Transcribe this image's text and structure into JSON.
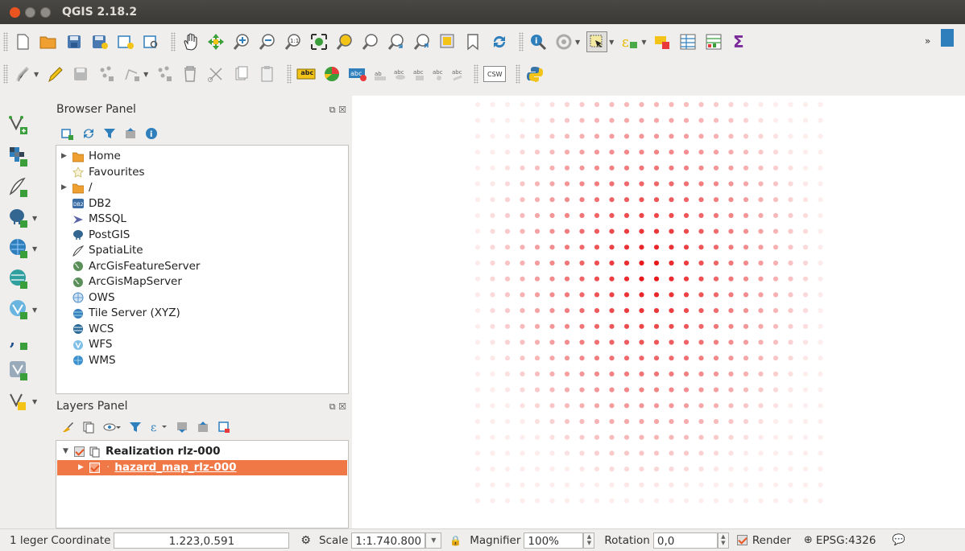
{
  "window": {
    "title": "QGIS 2.18.2"
  },
  "toolbar_row2": {
    "label_button": "abc",
    "csw_button": "CSW"
  },
  "browser_panel": {
    "title": "Browser Panel",
    "items": [
      {
        "label": "Home",
        "icon": "folder-icon",
        "expandable": true
      },
      {
        "label": "Favourites",
        "icon": "star-icon",
        "expandable": false
      },
      {
        "label": "/",
        "icon": "folder-icon",
        "expandable": true
      },
      {
        "label": "DB2",
        "icon": "db2-icon",
        "expandable": false
      },
      {
        "label": "MSSQL",
        "icon": "mssql-icon",
        "expandable": false
      },
      {
        "label": "PostGIS",
        "icon": "postgis-elephant-icon",
        "expandable": false
      },
      {
        "label": "SpatiaLite",
        "icon": "spatialite-feather-icon",
        "expandable": false
      },
      {
        "label": "ArcGisFeatureServer",
        "icon": "arcgis-globe-icon",
        "expandable": false
      },
      {
        "label": "ArcGisMapServer",
        "icon": "arcgis-globe-icon",
        "expandable": false
      },
      {
        "label": "OWS",
        "icon": "ows-globe-icon",
        "expandable": false
      },
      {
        "label": "Tile Server (XYZ)",
        "icon": "xyz-globe-icon",
        "expandable": false
      },
      {
        "label": "WCS",
        "icon": "wcs-globe-icon",
        "expandable": false
      },
      {
        "label": "WFS",
        "icon": "wfs-globe-icon",
        "expandable": false
      },
      {
        "label": "WMS",
        "icon": "wms-globe-icon",
        "expandable": false
      }
    ]
  },
  "layers_panel": {
    "title": "Layers Panel",
    "group": {
      "label": "Realization rlz-000",
      "checked": true,
      "expanded": true
    },
    "layer": {
      "label": "hazard_map_rlz-000",
      "checked": true,
      "selected": true
    }
  },
  "colors": {
    "accent": "#e95420",
    "selection": "#f07746",
    "point": "#e8191d",
    "titlebar": "#3c3b37"
  },
  "statusbar": {
    "legend_text": "1 leger",
    "coordinate_label": "Coordinate",
    "coordinate_value": "1.223,0.591",
    "scale_label": "Scale",
    "scale_value": "1:1.740.800",
    "magnifier_label": "Magnifier",
    "magnifier_value": "100%",
    "rotation_label": "Rotation",
    "rotation_value": "0,0",
    "render_label": "Render",
    "render_checked": true,
    "crs_label": "EPSG:4326"
  }
}
